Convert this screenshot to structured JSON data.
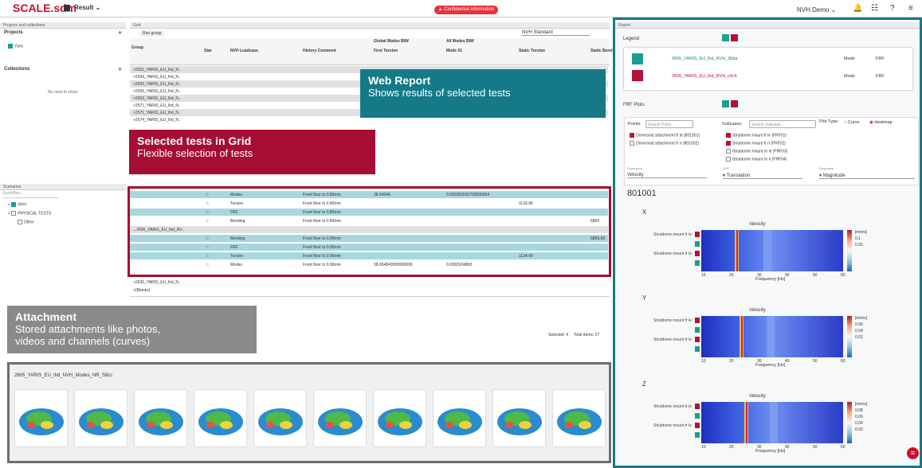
{
  "app": {
    "title": "SCALE.sdm",
    "result_label": "Result",
    "confidential": "Confidential information",
    "workspace": "NVH Demo"
  },
  "left": {
    "projects_tab": "Projects and collections",
    "projects": "Projects",
    "project_item": "Yaris",
    "collections": "Collections",
    "no_rows": "No rows to show",
    "scenarios_tab": "Scenarios",
    "quickfilter": "Quickfilter...",
    "tree": [
      "NVH",
      "PHYSICAL TESTS",
      "Other"
    ]
  },
  "grid": {
    "tab": "Grid",
    "run_group": "Run group",
    "nvh_standard": "NVH Standard",
    "cols": {
      "group": "Group",
      "star": "Star",
      "loadcase": "NVH Loadcase",
      "history": "History Comment",
      "global": "Global Modes BIW",
      "allmodes": "All Modes BIW",
      "first_torsion": "First Torsion",
      "mode01": "Mode 01",
      "static_torsion": "Static Torsion",
      "static_bend": "Static Bend"
    },
    "top_rows": [
      "2551_YARIS_EU_lhd_N..",
      "2554_YARIS_EU_lhd_N..",
      "2555_YARIS_EU_lhd_N..",
      "2556_YARIS_EU_lhd_N..",
      "2563_YARIS_EU_lhd_N..",
      "2571_YARIS_EU_lhd_N..",
      "2571_YARIS_EU_lhd_N..",
      "2574_YARIS_EU_lhd_N.."
    ],
    "sel_rows": [
      {
        "lc": "Modes",
        "hist": "Front floor to 0.80mm",
        "a": "38.64546",
        "b": "0.000283015700000004",
        "c": "",
        "d": ""
      },
      {
        "lc": "Torsion",
        "hist": "Front floor to 0.80mm",
        "a": "",
        "b": "",
        "c": "1133.99",
        "d": ""
      },
      {
        "lc": "FRF",
        "hist": "Front floor to 0.80mm",
        "a": "",
        "b": "",
        "c": "",
        "d": ""
      },
      {
        "lc": "Bending",
        "hist": "Front floor to 0.80mm",
        "a": "",
        "b": "",
        "c": "",
        "d": "5860"
      }
    ],
    "group2": "2606_YARIS_EU_lhd_NV..",
    "sel_rows2": [
      {
        "lc": "Bending",
        "hist": "Front floor to 0.90mm",
        "a": "",
        "b": "",
        "c": "",
        "d": "5859.69"
      },
      {
        "lc": "FRF",
        "hist": "Front floor to 0.90mm",
        "a": "",
        "b": "",
        "c": "",
        "d": ""
      },
      {
        "lc": "Torsion",
        "hist": "Front floor to 0.90mm",
        "a": "",
        "b": "",
        "c": "1134.49",
        "d": ""
      },
      {
        "lc": "Modes",
        "hist": "Front floor to 0.90mm",
        "a": "38.654849999999996",
        "b": "0.0002924858",
        "c": "",
        "d": ""
      }
    ],
    "bottom_rows": [
      "2636_YARIS_EU_lhd_N..",
      "(Blanks)"
    ],
    "selected": "Selected: 4",
    "total": "Total items: 27"
  },
  "callouts": {
    "web_title": "Web Report",
    "web_sub": "Shows results of selected tests",
    "grid_title": "Selected tests in Grid",
    "grid_sub": "Flexible selection of tests",
    "att_title": "Attachment",
    "att_sub1": "Stored attachments like photos,",
    "att_sub2": "videos and channels (curves)"
  },
  "attachment": {
    "header": "2605_YARIS_EU_lhd_NVH_Modes_NR_S8cc"
  },
  "report": {
    "tab": "Report",
    "legend": "Legend",
    "legend_rows": [
      {
        "name": "2605_YARIS_EU_lhd_NVH_3bba",
        "type": "Mode",
        "kind": "FRF",
        "color": "#1a9e8f"
      },
      {
        "name": "2606_YARIS_EU_lhd_NVH_c0c5",
        "type": "Mode",
        "kind": "FRF",
        "color": "#b3123a"
      }
    ],
    "frf": "FRF Plots",
    "points": "Points:",
    "points_ph": "Search Point...",
    "subcases": "Subcases:",
    "sub_ph": "Search Subcase...",
    "plottype": "Plot Type:",
    "curve": "Curve",
    "heatmap": "Heatmap",
    "point_items": [
      "Driverseat attachment fr le (801001)",
      "Driverseat attachment fr ri (801002)"
    ],
    "sub_items": [
      "Strutdome mount fr le (FRF01)",
      "Strutdome mount fr ri (FRF02)",
      "Strutdome mount re le (FRF03)",
      "Strutdome mount re ri (FRF04)"
    ],
    "dims": {
      "l1": "Dimension",
      "v1": "Velocity",
      "l2": "DOF",
      "v2": "Translation",
      "l3": "Response",
      "v3": "Magnitude"
    },
    "point_id": "801001",
    "plots": [
      {
        "axis": "X",
        "title": "Velocity",
        "ticks": [
          "0.1",
          "0.05"
        ]
      },
      {
        "axis": "Y",
        "title": "Velocity",
        "ticks": [
          "0.06",
          "0.04",
          "0.02"
        ]
      },
      {
        "axis": "Z",
        "title": "Velocity",
        "ticks": [
          "0.08",
          "0.06",
          "0.04",
          "0.02"
        ]
      }
    ],
    "unit": "[mm/s]",
    "rowlabel": "Strutdome mount fr le",
    "xlabel": "Frequency [Hz]",
    "xticks": [
      "10",
      "20",
      "30",
      "40",
      "50",
      "60"
    ]
  }
}
